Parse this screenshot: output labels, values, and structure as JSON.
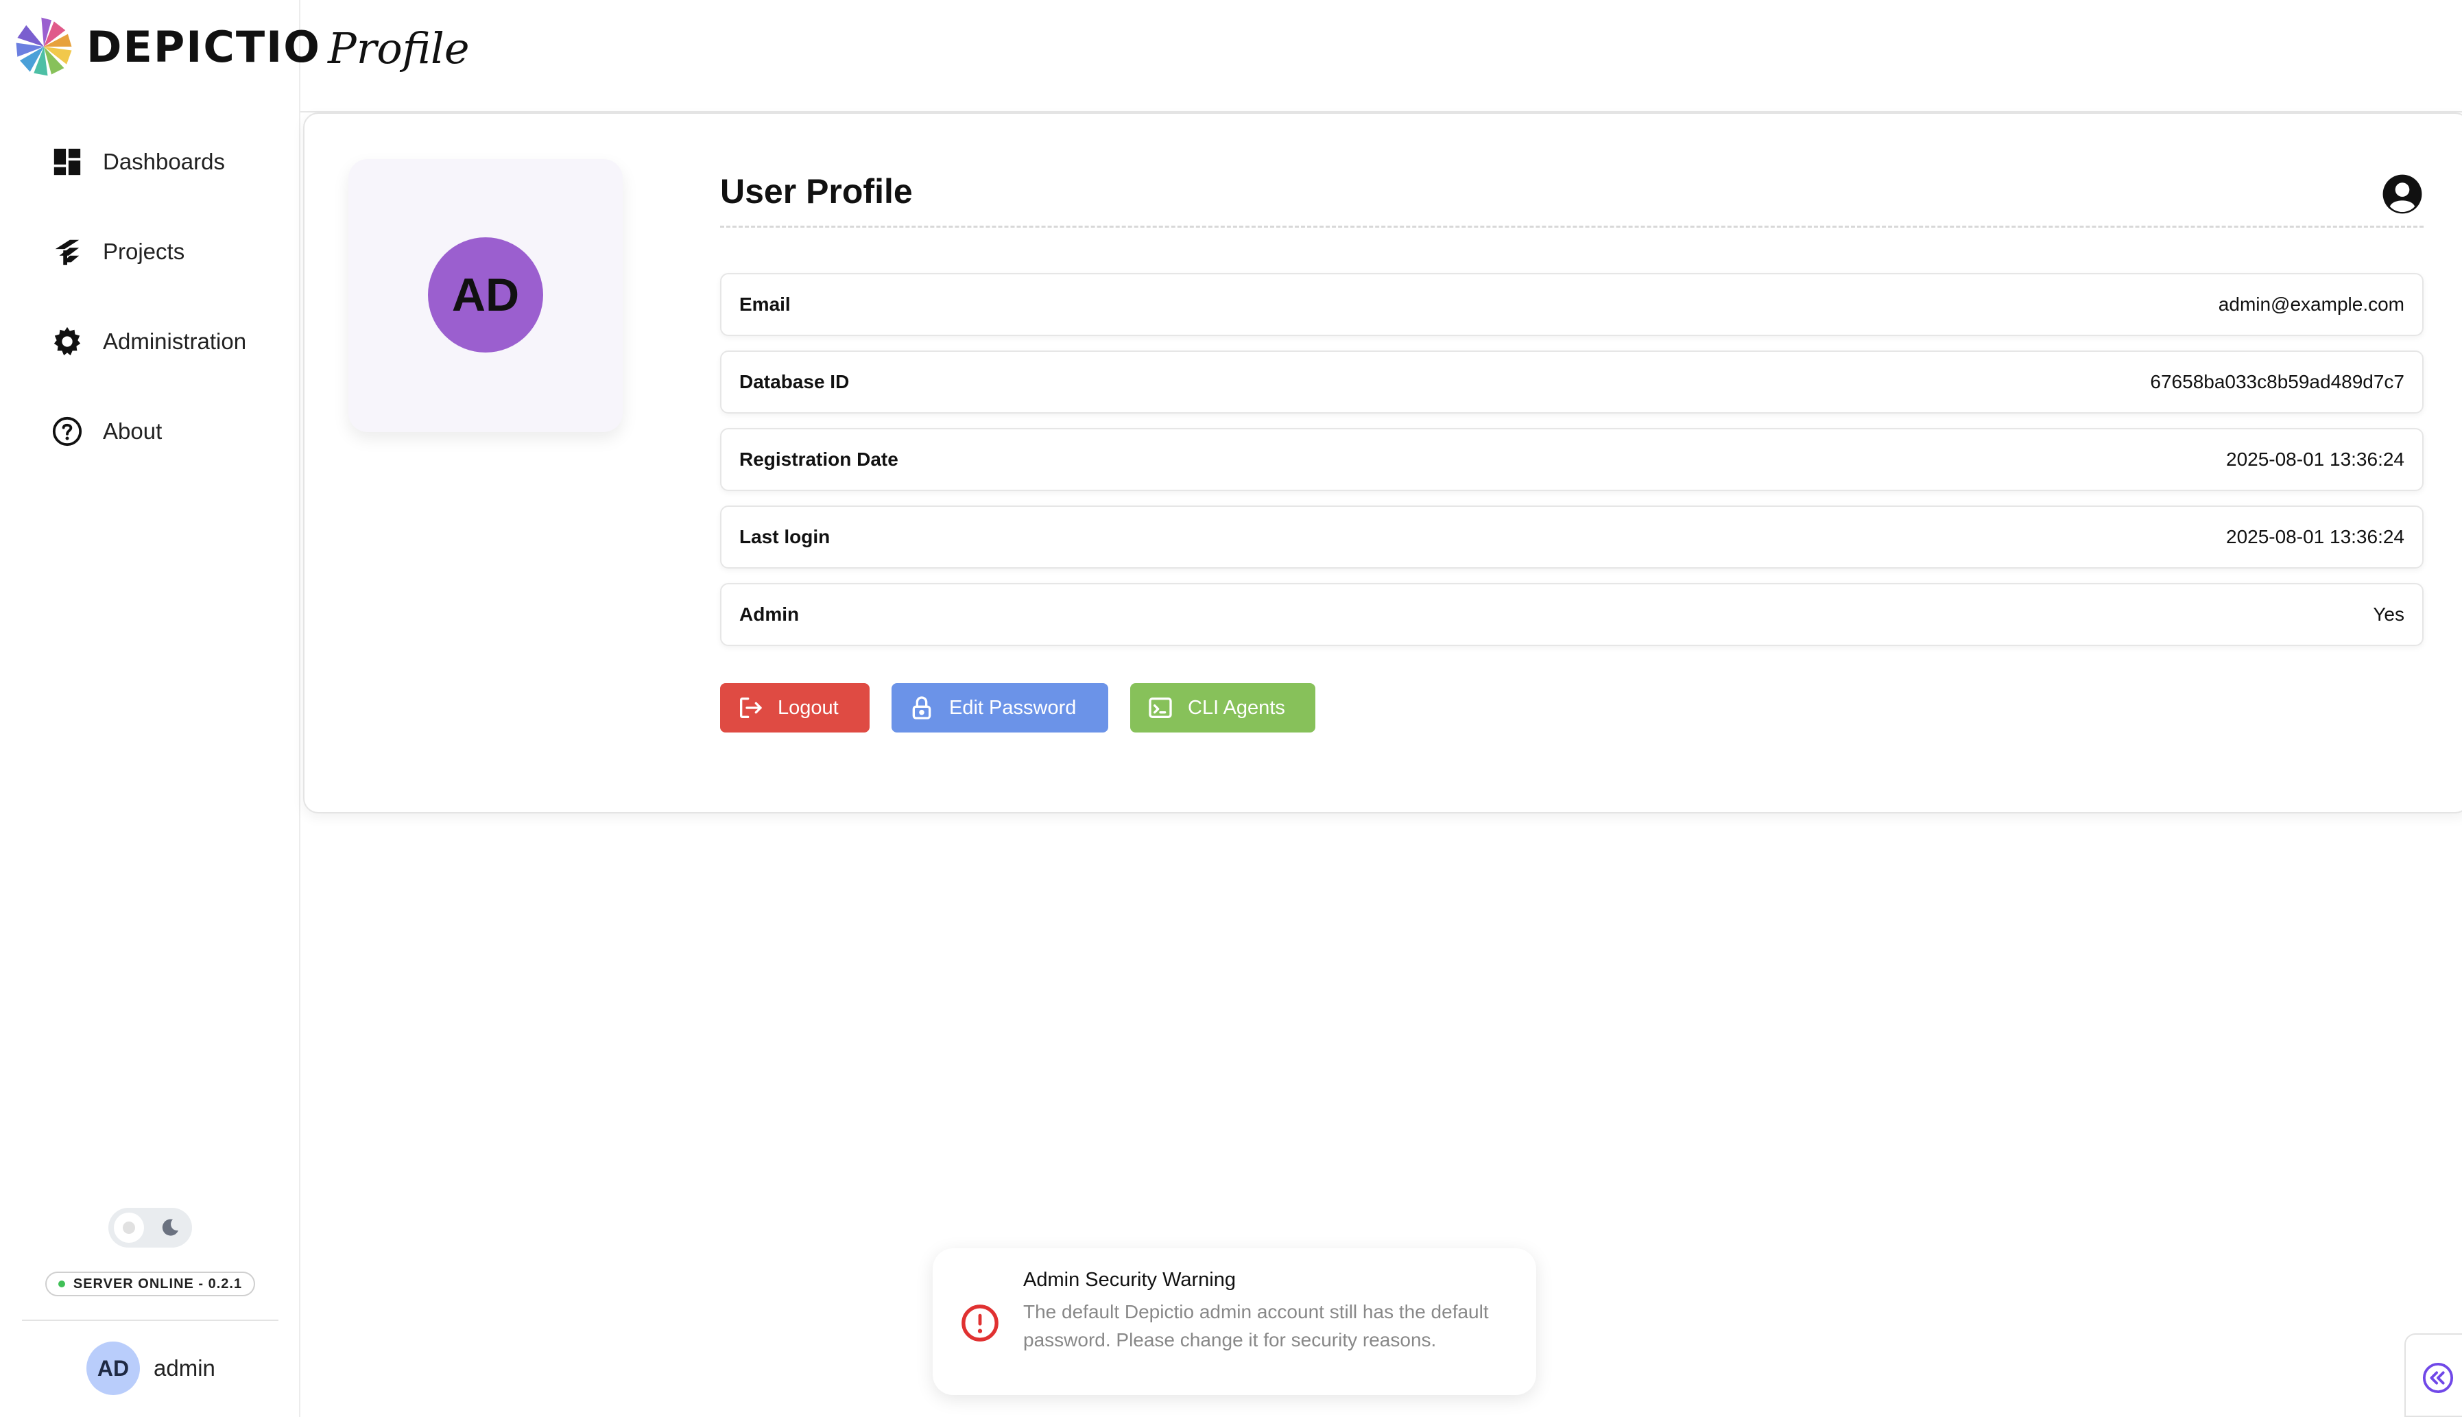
{
  "app": {
    "name": "DEPICTIO",
    "page_title": "Profile"
  },
  "sidebar": {
    "items": [
      {
        "label": "Dashboards",
        "icon": "dashboard-icon"
      },
      {
        "label": "Projects",
        "icon": "projects-icon"
      },
      {
        "label": "Administration",
        "icon": "gear-icon"
      },
      {
        "label": "About",
        "icon": "help-circle-icon"
      }
    ],
    "server_status": "SERVER ONLINE - 0.2.1",
    "user": {
      "initials": "AD",
      "name": "admin"
    }
  },
  "profile": {
    "avatar_initials": "AD",
    "section_title": "User Profile",
    "fields": [
      {
        "label": "Email",
        "value": "admin@example.com"
      },
      {
        "label": "Database ID",
        "value": "67658ba033c8b59ad489d7c7"
      },
      {
        "label": "Registration Date",
        "value": "2025-08-01 13:36:24"
      },
      {
        "label": "Last login",
        "value": "2025-08-01 13:36:24"
      },
      {
        "label": "Admin",
        "value": "Yes"
      }
    ],
    "buttons": {
      "logout": "Logout",
      "edit_password": "Edit Password",
      "cli_agents": "CLI Agents"
    }
  },
  "notification": {
    "title": "Admin Security Warning",
    "message": "The default Depictio admin account still has the default password. Please change it for security reasons."
  },
  "colors": {
    "logout": "#df4b43",
    "edit_password": "#6b93e8",
    "cli_agents": "#87c15a",
    "avatar": "#9b5fcf",
    "user_avatar": "#b9cdfb",
    "server_online": "#40c057",
    "warning": "#e03131"
  }
}
